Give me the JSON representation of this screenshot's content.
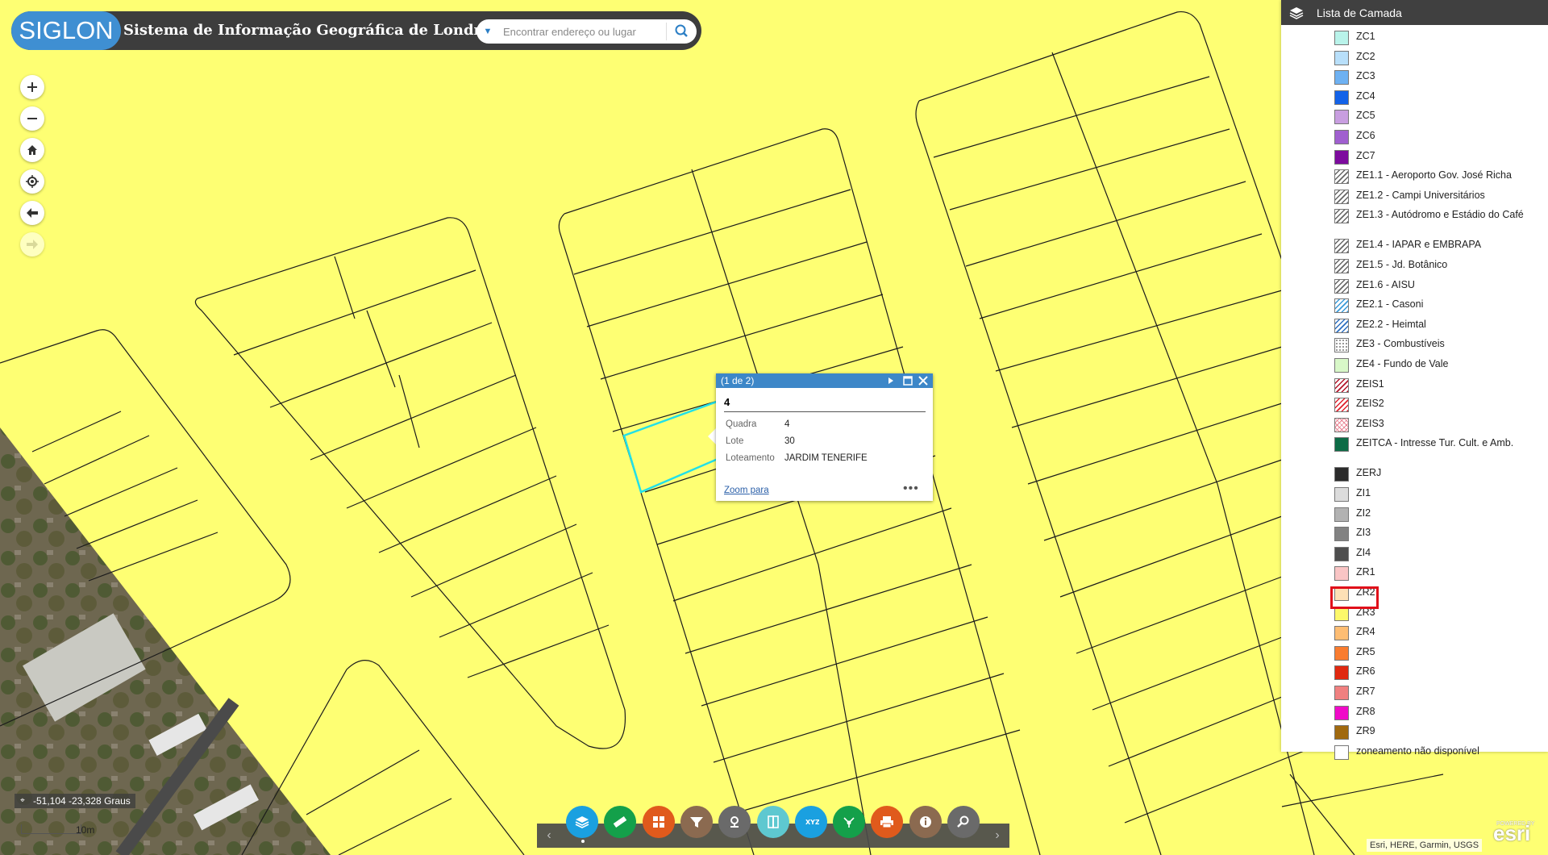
{
  "header": {
    "logo_text": "SIGLON",
    "title": "Sistema de Informação Geográfica de Londrina",
    "search_placeholder": "Encontrar endereço ou lugar"
  },
  "map_nav": [
    "zoom-in",
    "zoom-out",
    "home",
    "locate",
    "previous-extent",
    "next-extent"
  ],
  "layer_list": {
    "title": "Lista de Camada",
    "items": [
      {
        "label": "ZC1",
        "color": "#b9f3ea",
        "pattern": "solid"
      },
      {
        "label": "ZC2",
        "color": "#b8dffa",
        "pattern": "solid"
      },
      {
        "label": "ZC3",
        "color": "#6eb1f2",
        "pattern": "solid"
      },
      {
        "label": "ZC4",
        "color": "#1362e8",
        "pattern": "solid"
      },
      {
        "label": "ZC5",
        "color": "#c89ee0",
        "pattern": "solid"
      },
      {
        "label": "ZC6",
        "color": "#a05fcf",
        "pattern": "solid"
      },
      {
        "label": "ZC7",
        "color": "#7d0b9e",
        "pattern": "solid"
      },
      {
        "label": "ZE1.1 - Aeroporto Gov. José Richa",
        "color": "#666666",
        "pattern": "hatch"
      },
      {
        "label": "ZE1.2 - Campi Universitários",
        "color": "#666666",
        "pattern": "hatch"
      },
      {
        "label": "ZE1.3 - Autódromo e Estádio do Café",
        "color": "#666666",
        "pattern": "hatch"
      },
      {
        "label": "ZE1.4 - IAPAR e EMBRAPA",
        "color": "#666666",
        "pattern": "hatch"
      },
      {
        "label": "ZE1.5 - Jd. Botânico",
        "color": "#666666",
        "pattern": "hatch"
      },
      {
        "label": "ZE1.6 - AISU",
        "color": "#666666",
        "pattern": "hatch"
      },
      {
        "label": "ZE2.1 - Casoni",
        "color": "#3a9ad9",
        "pattern": "hatch"
      },
      {
        "label": "ZE2.2 - Heimtal",
        "color": "#2d6fc0",
        "pattern": "hatch"
      },
      {
        "label": "ZE3 - Combustíveis",
        "color": "#777777",
        "pattern": "dots"
      },
      {
        "label": "ZE4 - Fundo de Vale",
        "color": "#d8f8c8",
        "pattern": "solid"
      },
      {
        "label": "ZEIS1",
        "color": "#b5142a",
        "pattern": "hatch"
      },
      {
        "label": "ZEIS2",
        "color": "#e0202c",
        "pattern": "hatch"
      },
      {
        "label": "ZEIS3",
        "color": "#e88090",
        "pattern": "cross"
      },
      {
        "label": "ZEITCA - Intresse Tur. Cult. e Amb.",
        "color": "#0d6b46",
        "pattern": "solid"
      },
      {
        "label": "ZERJ",
        "color": "#2b2b2b",
        "pattern": "solid"
      },
      {
        "label": "ZI1",
        "color": "#dcdcdc",
        "pattern": "solid"
      },
      {
        "label": "ZI2",
        "color": "#b2b2b2",
        "pattern": "solid"
      },
      {
        "label": "ZI3",
        "color": "#828282",
        "pattern": "solid"
      },
      {
        "label": "ZI4",
        "color": "#4e4e4e",
        "pattern": "solid"
      },
      {
        "label": "ZR1",
        "color": "#f9c5c5",
        "pattern": "solid"
      },
      {
        "label": "ZR2",
        "color": "#fde0b6",
        "pattern": "solid"
      },
      {
        "label": "ZR3",
        "color": "#fcf86a",
        "pattern": "solid"
      },
      {
        "label": "ZR4",
        "color": "#fdbd73",
        "pattern": "solid"
      },
      {
        "label": "ZR5",
        "color": "#f97c2f",
        "pattern": "solid"
      },
      {
        "label": "ZR6",
        "color": "#e02810",
        "pattern": "solid"
      },
      {
        "label": "ZR7",
        "color": "#f08080",
        "pattern": "solid"
      },
      {
        "label": "ZR8",
        "color": "#f00ac8",
        "pattern": "solid"
      },
      {
        "label": "ZR9",
        "color": "#a0690f",
        "pattern": "solid"
      },
      {
        "label": "zoneamento não disponível",
        "color": "#ffffff",
        "pattern": "solid"
      }
    ]
  },
  "popup": {
    "counter": "(1 de 2)",
    "title": "4",
    "fields": [
      {
        "key": "Quadra",
        "value": "4"
      },
      {
        "key": "Lote",
        "value": "30"
      },
      {
        "key": "Loteamento",
        "value": "JARDIM TENERIFE"
      }
    ],
    "zoom_link": "Zoom para",
    "more": "•••"
  },
  "toolbar": {
    "tools": [
      {
        "name": "layers",
        "color": "#1aa0e0"
      },
      {
        "name": "measure",
        "color": "#14a04a"
      },
      {
        "name": "basemap-gallery",
        "color": "#e05a1c"
      },
      {
        "name": "filter",
        "color": "#8b6a50"
      },
      {
        "name": "geolocate",
        "color": "#6a6a6a"
      },
      {
        "name": "swipe",
        "color": "#5ec8d0"
      },
      {
        "name": "coordinates",
        "color": "#1aa0e0"
      },
      {
        "name": "share",
        "color": "#14a04a"
      },
      {
        "name": "print",
        "color": "#e05a1c"
      },
      {
        "name": "about",
        "color": "#8b6a50"
      },
      {
        "name": "query",
        "color": "#6a6a6a"
      }
    ]
  },
  "coordinates": "-51,104 -23,328 Graus",
  "scale_label": "10m",
  "attribution": "Esri, HERE, Garmin, USGS",
  "esri_logo": "esri",
  "esri_powered": "POWERED BY"
}
